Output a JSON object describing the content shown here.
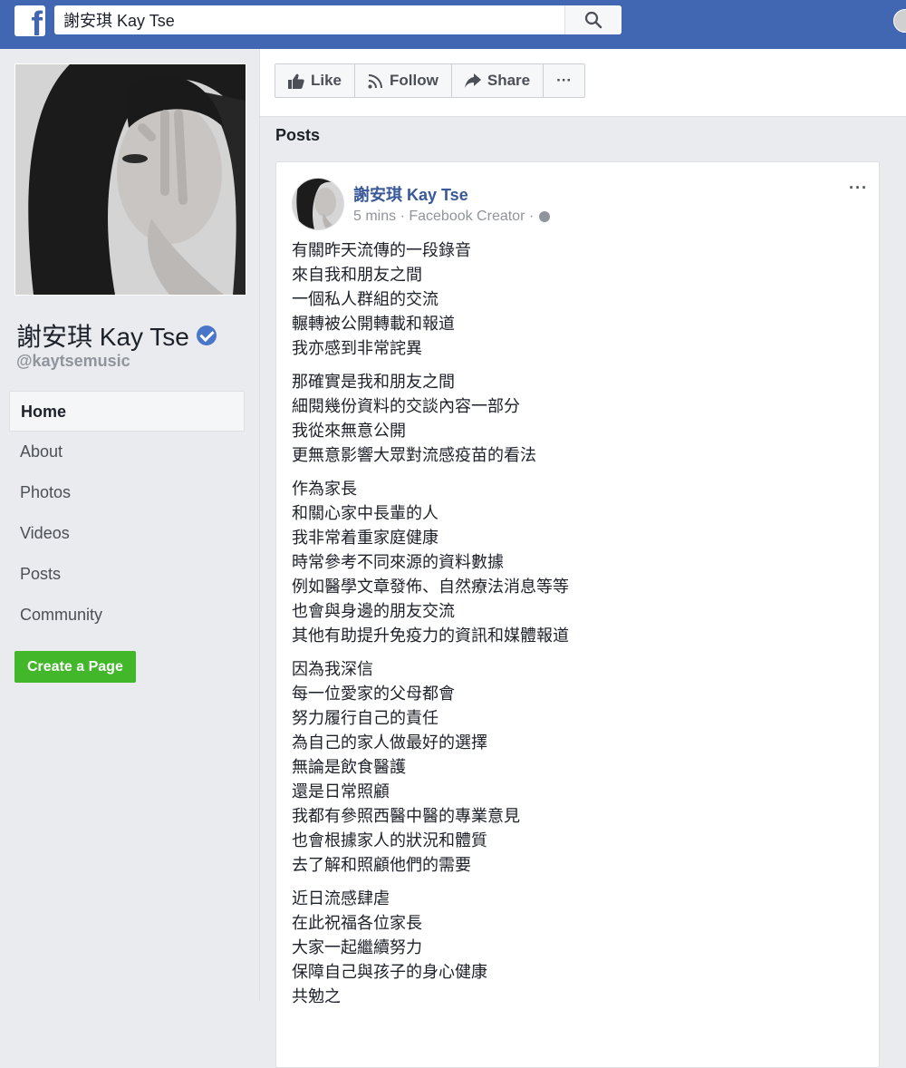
{
  "topbar": {
    "search_value": "謝安琪 Kay Tse",
    "colors": {
      "brand": "#4267b2"
    }
  },
  "sidebar": {
    "page_name": "謝安琪 Kay Tse",
    "handle": "@kaytsemusic",
    "items": [
      {
        "label": "Home"
      },
      {
        "label": "About"
      },
      {
        "label": "Photos"
      },
      {
        "label": "Videos"
      },
      {
        "label": "Posts"
      },
      {
        "label": "Community"
      }
    ],
    "create_page_label": "Create a Page"
  },
  "actions": {
    "like_label": "Like",
    "follow_label": "Follow",
    "share_label": "Share",
    "more_label": "···"
  },
  "posts_heading": "Posts",
  "post": {
    "author": "謝安琪 Kay Tse",
    "time": "5 mins",
    "role": "Facebook Creator",
    "more_label": "···",
    "paragraphs": [
      [
        "有關昨天流傳的一段錄音",
        "來自我和朋友之間",
        "一個私人群組的交流",
        "輾轉被公開轉載和報道",
        "我亦感到非常詫異"
      ],
      [
        "那確實是我和朋友之間",
        "細閱幾份資料的交談內容一部分",
        "我從來無意公開",
        "更無意影響大眾對流感疫苗的看法"
      ],
      [
        "作為家長",
        "和關心家中長輩的人",
        "我非常着重家庭健康",
        "時常參考不同來源的資料數據",
        "例如醫學文章發佈、自然療法消息等等",
        "也會與身邊的朋友交流",
        "其他有助提升免疫力的資訊和媒體報道"
      ],
      [
        "因為我深信",
        "每一位愛家的父母都會",
        "努力履行自己的責任",
        "為自己的家人做最好的選擇",
        "無論是飲食醫護",
        "還是日常照顧",
        "我都有參照西醫中醫的專業意見",
        "也會根據家人的狀況和體質",
        "去了解和照顧他們的需要"
      ],
      [
        "近日流感肆虐",
        "在此祝福各位家長",
        "大家一起繼續努力",
        "保障自己與孩子的身心健康",
        "共勉之"
      ]
    ]
  }
}
